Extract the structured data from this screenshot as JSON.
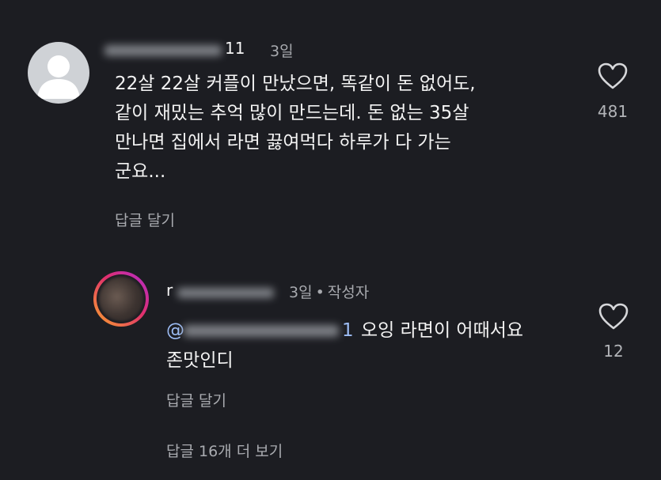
{
  "comment": {
    "username_visible": "11",
    "time": "3일",
    "lines": [
      "22살 22살 커플이 만났으면, 똑같이 돈 없어도,",
      "같이 재밌는 추억 많이 만드는데. 돈 없는 35살",
      "만나면 집에서 라면 끓여먹다 하루가 다 가는",
      "군요..."
    ],
    "reply_label": "답글 달기",
    "like_count": "481"
  },
  "reply": {
    "username_visible": "r",
    "time": "3일",
    "author_badge": "작성자",
    "mention_visible": "@",
    "mention_tail": "1",
    "line1": "오잉 라면이 어때서요",
    "line2": "존맛인디",
    "reply_label": "답글 달기",
    "like_count": "12"
  },
  "more_replies_label": "답글 16개 더 보기",
  "colors": {
    "background": "#1c1d22",
    "mention": "#9dbdf5",
    "muted_text": "#a7a9ae"
  }
}
